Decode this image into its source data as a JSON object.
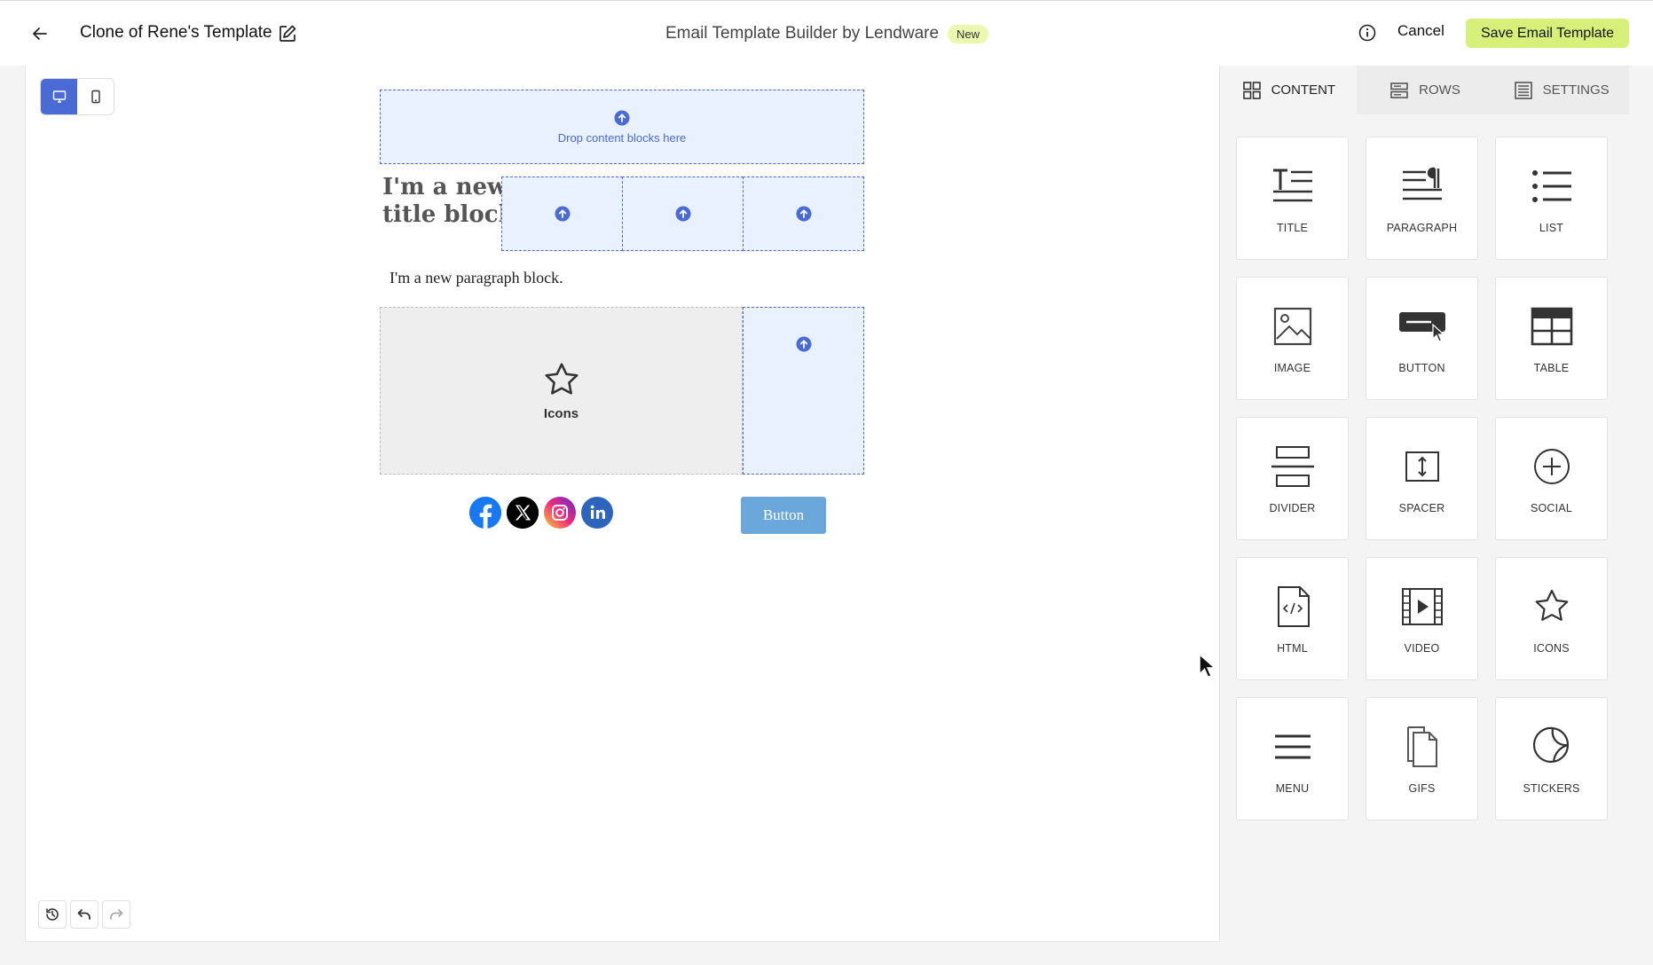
{
  "header": {
    "template_name": "Clone of Rene's Template",
    "app_title": "Email Template Builder by Lendware",
    "badge": "New",
    "cancel_label": "Cancel",
    "save_label": "Save Email Template"
  },
  "canvas": {
    "drop_text": "Drop content blocks here",
    "title_block": "I'm a new title block",
    "paragraph_block": "I'm a new paragraph block.",
    "icons_label": "Icons",
    "button_label": "Button",
    "social": [
      "facebook",
      "x",
      "instagram",
      "linkedin"
    ]
  },
  "panel": {
    "tabs": [
      {
        "label": "CONTENT",
        "icon": "grid-icon"
      },
      {
        "label": "ROWS",
        "icon": "rows-icon"
      },
      {
        "label": "SETTINGS",
        "icon": "settings-icon"
      }
    ],
    "blocks": [
      {
        "label": "TITLE",
        "icon": "title-icon"
      },
      {
        "label": "PARAGRAPH",
        "icon": "paragraph-icon"
      },
      {
        "label": "LIST",
        "icon": "list-icon"
      },
      {
        "label": "IMAGE",
        "icon": "image-icon"
      },
      {
        "label": "BUTTON",
        "icon": "button-icon"
      },
      {
        "label": "TABLE",
        "icon": "table-icon"
      },
      {
        "label": "DIVIDER",
        "icon": "divider-icon"
      },
      {
        "label": "SPACER",
        "icon": "spacer-icon"
      },
      {
        "label": "SOCIAL",
        "icon": "social-icon"
      },
      {
        "label": "HTML",
        "icon": "html-icon"
      },
      {
        "label": "VIDEO",
        "icon": "video-icon"
      },
      {
        "label": "ICONS",
        "icon": "star-icon"
      },
      {
        "label": "MENU",
        "icon": "menu-icon"
      },
      {
        "label": "GIFS",
        "icon": "gifs-icon"
      },
      {
        "label": "STICKERS",
        "icon": "stickers-icon"
      }
    ]
  },
  "colors": {
    "accent": "#4a6ad6",
    "save": "#d6f07a",
    "badge": "#eaf8b0",
    "email_button": "#6aa8db"
  }
}
